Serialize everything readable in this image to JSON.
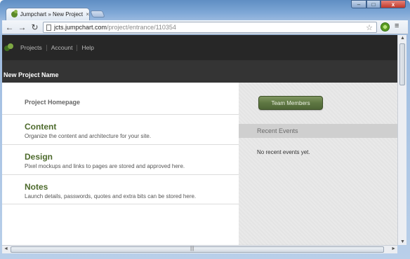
{
  "browser": {
    "tab_title": "Jumpchart » New Project N",
    "tab_close": "×",
    "window_min": "–",
    "window_max": "□",
    "window_close": "x",
    "url_host": "jcts.jumpchart.com",
    "url_path": "/project/entrance/110354",
    "back": "←",
    "forward": "→",
    "reload": "↻",
    "star": "☆",
    "menu": "≡"
  },
  "app_nav": {
    "items": [
      "Projects",
      "Account",
      "Help"
    ]
  },
  "project": {
    "name": "New Project Name",
    "homepage_label": "Project Homepage"
  },
  "sections": [
    {
      "title": "Content",
      "description": "Organize the content and architecture for your site."
    },
    {
      "title": "Design",
      "description": "Pixel mockups and links to pages are stored and approved here."
    },
    {
      "title": "Notes",
      "description": "Launch details, passwords, quotes and extra bits can be stored here."
    }
  ],
  "sidebar": {
    "team_button": "Team Members",
    "recent_events_title": "Recent Events",
    "no_events": "No recent events yet."
  },
  "scroll": {
    "grip": "|||",
    "up": "▲",
    "down": "▼",
    "left": "◄",
    "right": "►"
  },
  "colors": {
    "accent_green": "#4d6a2c",
    "nav_bg": "#272727",
    "title_bg": "#343434"
  }
}
